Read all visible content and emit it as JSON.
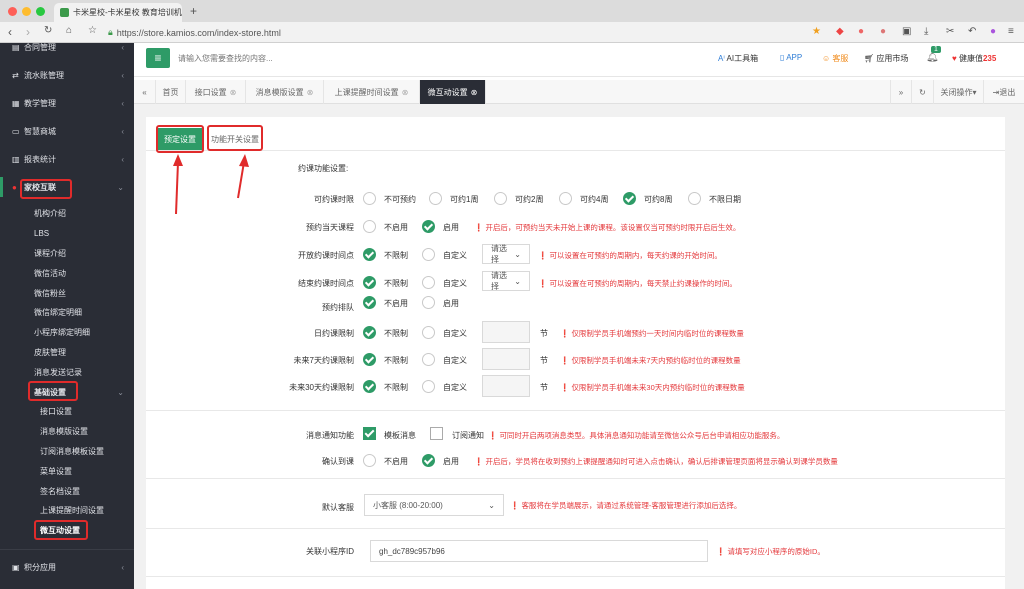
{
  "browser": {
    "tab_title": "卡米星校-卡米星校 教育培训机",
    "new_tab": "+",
    "url": "https://store.kamios.com/index-store.html"
  },
  "sidebar": {
    "items": [
      {
        "label": "合同管理",
        "icon": "doc-icon"
      },
      {
        "label": "流水账管理",
        "icon": "flow-icon"
      },
      {
        "label": "教学管理",
        "icon": "calendar-icon"
      },
      {
        "label": "智慧商城",
        "icon": "shop-icon"
      },
      {
        "label": "报表统计",
        "icon": "chart-icon"
      },
      {
        "label": "家校互联",
        "icon": "link-icon"
      }
    ],
    "sub_items": [
      "机构介绍",
      "LBS",
      "课程介绍",
      "微信活动",
      "微信粉丝",
      "微信绑定明细",
      "小程序绑定明细",
      "皮肤管理",
      "消息发送记录"
    ],
    "group2": "基础设置",
    "sub2": [
      "接口设置",
      "消息模版设置",
      "订阅消息模板设置",
      "菜单设置",
      "签名档设置",
      "上课提醒时间设置",
      "微互动设置"
    ],
    "bottom": "积分应用"
  },
  "topbar": {
    "search_placeholder": "请输入您需要查找的内容...",
    "ai": "AI工具箱",
    "app": "APP",
    "service": "客服",
    "market": "应用市场",
    "badge": "1",
    "health_label": "健康值",
    "health_value": "235"
  },
  "tabs": [
    "首页",
    "接口设置",
    "消息模版设置",
    "上课提醒时间设置",
    "微互动设置"
  ],
  "tab_actions": {
    "close_ops": "关闭操作",
    "logout": "退出"
  },
  "panel": {
    "tab_preset": "预定设置",
    "tab_switch": "功能开关设置",
    "section_title": "约课功能设置:",
    "rows": {
      "bookable": {
        "label": "可约课时限",
        "options": [
          "不可预约",
          "可约1周",
          "可约2周",
          "可约4周",
          "可约8周",
          "不限日期"
        ]
      },
      "sameday": {
        "label": "预约当天课程",
        "options": [
          "不启用",
          "启用"
        ],
        "hint": "开启后，可预约当天未开始上课的课程。该设置仅当可预约时限开启后生效。"
      },
      "opentime": {
        "label": "开放约课时间点",
        "options": [
          "不限制",
          "自定义"
        ],
        "select": "请选择",
        "hint": "可以设置在可预约的周期内，每天约课的开始时间。"
      },
      "endtime": {
        "label": "结束约课时间点",
        "options": [
          "不限制",
          "自定义"
        ],
        "select": "请选择",
        "hint": "可以设置在可预约的周期内，每天禁止约课操作的时间。"
      },
      "queue": {
        "label": "预约排队",
        "options": [
          "不启用",
          "启用"
        ]
      },
      "daily": {
        "label": "日约课限制",
        "options": [
          "不限制",
          "自定义"
        ],
        "unit": "节",
        "hint": "仅限制学员手机端预约一天时间内临时位的课程数量"
      },
      "week7": {
        "label": "未来7天约课限制",
        "options": [
          "不限制",
          "自定义"
        ],
        "unit": "节",
        "hint": "仅限制学员手机端未来7天内预约临时位的课程数量"
      },
      "day30": {
        "label": "未来30天约课限制",
        "options": [
          "不限制",
          "自定义"
        ],
        "unit": "节",
        "hint": "仅限制学员手机端未来30天内预约临时位的课程数量"
      }
    },
    "notify": {
      "label": "消息通知功能",
      "options": [
        "模板消息",
        "订阅通知"
      ],
      "hint": "可同时开启两项消息类型。具体消息通知功能请至微信公众号后台申请相应功能服务。"
    },
    "confirm": {
      "label": "确认到课",
      "options": [
        "不启用",
        "启用"
      ],
      "hint": "开启后，学员将在收到预约上课提醒通知时可进入点击确认，确认后排课管理页面将显示确认到课学员数量"
    },
    "service": {
      "label": "默认客服",
      "value": "小客服 (8:00-20:00)",
      "hint": "客服将在学员端展示，请通过系统管理-客服管理进行添加后选择。"
    },
    "miniapp": {
      "label": "关联小程序ID",
      "value": "gh_dc789c957b96",
      "hint": "请填写对应小程序的原始ID。"
    }
  },
  "colors": {
    "accent": "#2e9b67",
    "sidebar": "#2a2d36",
    "hint": "#e4393c",
    "annot": "#e02b2b"
  }
}
